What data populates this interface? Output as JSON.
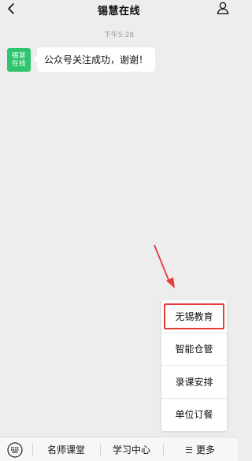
{
  "navbar": {
    "title": "锡慧在线"
  },
  "chat": {
    "timestamp": "下午5:28",
    "avatar_text": "锡慧在线",
    "message": "公众号关注成功，谢谢！"
  },
  "popup_menu": {
    "items": [
      "无锡教育",
      "智能仓管",
      "录课安排",
      "单位订餐"
    ],
    "highlight_color": "#e43b3b"
  },
  "bottom_bar": {
    "tabs": [
      "名师课堂",
      "学习中心",
      "更多"
    ]
  },
  "colors": {
    "avatar_green": "#2fc56e",
    "background": "#ededed",
    "arrow_red": "#e43b3b"
  },
  "icons": {
    "back": "chevron-left-icon",
    "profile": "user-icon",
    "keyboard": "keyboard-icon",
    "more_menu": "menu-icon"
  }
}
